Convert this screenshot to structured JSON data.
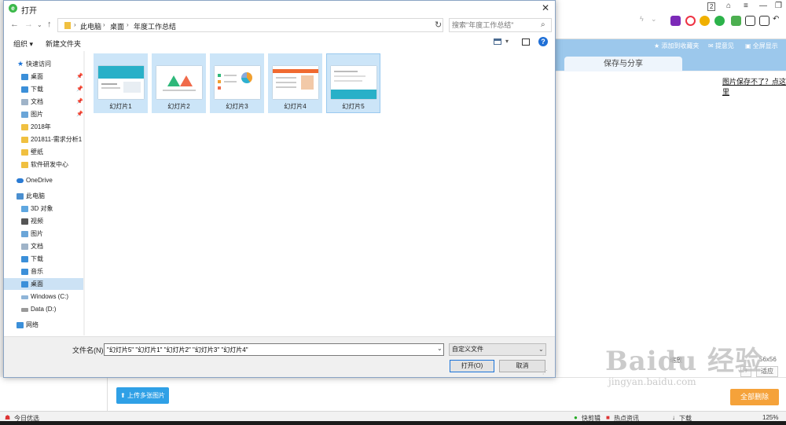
{
  "dialog": {
    "title": "打开",
    "close": "✕",
    "breadcrumb": [
      "此电脑",
      "桌面",
      "年度工作总结"
    ],
    "search_placeholder": "搜索\"年度工作总结\"",
    "organize": "组织 ▾",
    "new_folder": "新建文件夹",
    "sidebar": {
      "quick_access": "快速访问",
      "pinned": [
        {
          "label": "桌面"
        },
        {
          "label": "下载"
        },
        {
          "label": "文档"
        },
        {
          "label": "图片"
        }
      ],
      "recent": [
        "2018年",
        "201811-需求分析1",
        "壁纸",
        "软件研发中心"
      ],
      "onedrive": "OneDrive",
      "this_pc": "此电脑",
      "pc_items": [
        "3D 对象",
        "视频",
        "图片",
        "文档",
        "下载",
        "音乐",
        "桌面",
        "Windows (C:)",
        "Data (D:)"
      ],
      "network": "网络"
    },
    "files": [
      "幻灯片1",
      "幻灯片2",
      "幻灯片3",
      "幻灯片4",
      "幻灯片5"
    ],
    "filename_label": "文件名(N):",
    "filename_value": "\"幻灯片5\" \"幻灯片1\" \"幻灯片2\" \"幻灯片3\" \"幻灯片4\"",
    "filter": "自定义文件",
    "open_button": "打开(O)",
    "cancel_button": "取消"
  },
  "browser": {
    "tab_badge": "2",
    "banner_items": [
      "添加到收藏夹",
      "提意见",
      "全屏显示"
    ],
    "tab_label": "保存与分享",
    "help_link": "图片保存不了？点这里",
    "upload_button": "上传多张图片",
    "delete_button": "全部删除",
    "size_label": "56x56",
    "apply_button": "适应",
    "zoom_label": "缩放",
    "watermark_main": "Baidu 经验",
    "watermark_sub": "jingyan.baidu.com",
    "status": {
      "left": "今日优选",
      "quick_clip": "快剪辑",
      "hot_news": "热点资讯",
      "download": "下载",
      "zoom": "125%"
    }
  },
  "colors": {
    "selection": "#cce5f8",
    "sidebar_selected": "#cce2f5",
    "banner": "#9cc8ec",
    "upload": "#2fa0e6",
    "delete": "#f5a23a",
    "help_icon": "#1f6fd6"
  }
}
